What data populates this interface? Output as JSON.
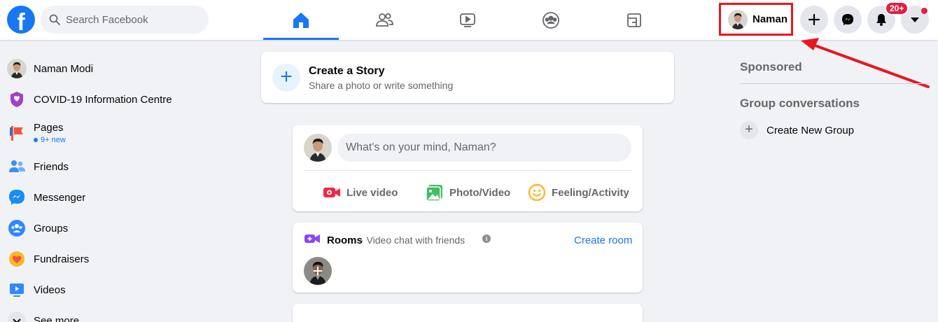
{
  "topbar": {
    "logo_letter": "f",
    "search_placeholder": "Search Facebook",
    "nav_tabs": [
      "home-icon",
      "friends-icon",
      "watch-icon",
      "groups-icon",
      "gaming-icon"
    ],
    "profile_name": "Naman",
    "notifications_badge": "20+",
    "brand_color": "#1877f2",
    "highlight_color": "#e8171f"
  },
  "sidebar": {
    "items": [
      {
        "label": "Naman Modi",
        "icon": "avatar"
      },
      {
        "label": "COVID-19 Information Centre",
        "icon": "covid-shield-icon"
      },
      {
        "label": "Pages",
        "sub": "9+ new",
        "icon": "pages-flag-icon"
      },
      {
        "label": "Friends",
        "icon": "friends-icon"
      },
      {
        "label": "Messenger",
        "icon": "messenger-icon"
      },
      {
        "label": "Groups",
        "icon": "groups-icon"
      },
      {
        "label": "Fundraisers",
        "icon": "fundraiser-heart-icon"
      },
      {
        "label": "Videos",
        "icon": "video-icon"
      },
      {
        "label": "See more",
        "icon": "chevron-down-icon"
      }
    ]
  },
  "story": {
    "title": "Create a Story",
    "subtitle": "Share a photo or write something"
  },
  "composer": {
    "placeholder": "What's on your mind, Naman?",
    "actions": [
      "Live video",
      "Photo/Video",
      "Feeling/Activity"
    ]
  },
  "rooms": {
    "title": "Rooms",
    "subtitle": "· Video chat with friends",
    "create_label": "Create room"
  },
  "right": {
    "sponsored": "Sponsored",
    "group_conversations": "Group conversations",
    "create_group": "Create New Group"
  }
}
